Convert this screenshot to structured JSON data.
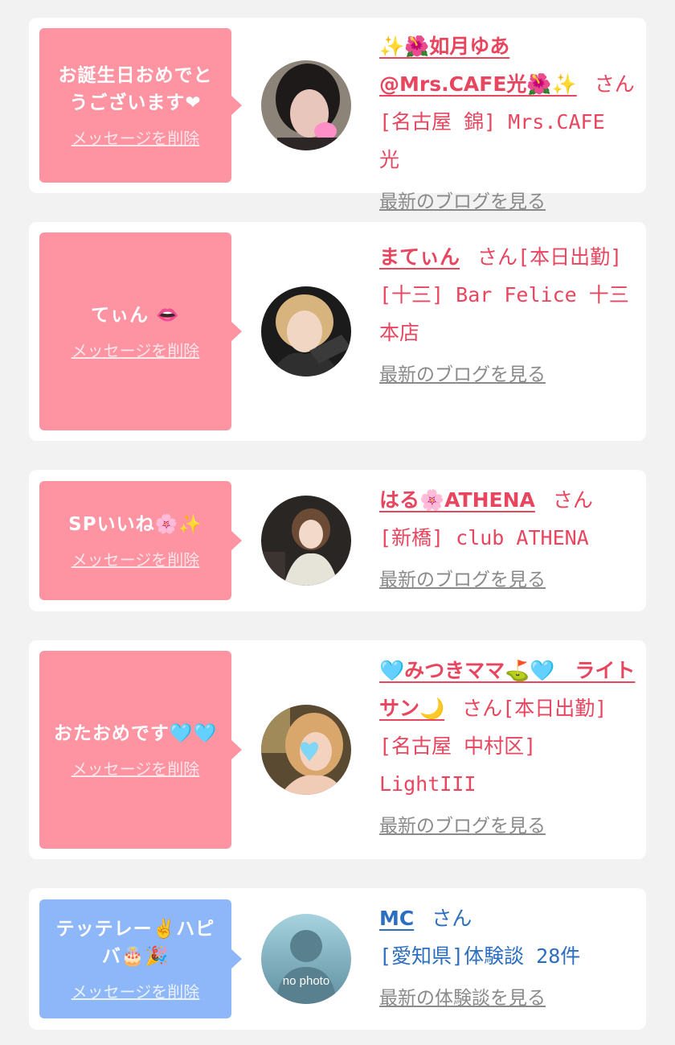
{
  "items": [
    {
      "theme": "pink",
      "message": "お誕生日おめでとうございます❤",
      "delete_label": "メッセージを削除",
      "name": "✨🌺如月ゆあ@Mrs.CAFE光🌺✨",
      "san": "さん",
      "after": "",
      "store": "[名古屋 錦] Mrs.CAFE 光",
      "link": "最新のブログを見る"
    },
    {
      "theme": "pink",
      "message": "てぃん 👄",
      "delete_label": "メッセージを削除",
      "name": "まてぃん",
      "san": "さん",
      "after": "[本日出勤]",
      "store": "[十三] Bar Felice 十三本店",
      "link": "最新のブログを見る"
    },
    {
      "theme": "pink",
      "message": "SPいいね🌸✨",
      "delete_label": "メッセージを削除",
      "name": "はる🌸ATHENA",
      "san": "さん",
      "after": "",
      "store": "[新橋] club ATHENA",
      "link": "最新のブログを見る"
    },
    {
      "theme": "pink",
      "message": "おたおめです🩵🩵",
      "delete_label": "メッセージを削除",
      "name": "🩵みつきママ⛳️🩵　ライトサン🌙",
      "san": "さん",
      "after": "[本日出勤]",
      "store": "[名古屋 中村区] LightIII",
      "link": "最新のブログを見る"
    },
    {
      "theme": "blue",
      "message": "テッテレー✌️ハピバ🎂🎉",
      "delete_label": "メッセージを削除",
      "name": "MC",
      "san": "さん",
      "after": "",
      "store": "[愛知県]体験談 28件",
      "link": "最新の体験談を見る",
      "avatar_text": "no photo"
    }
  ],
  "colors": {
    "bubble_pink": "#fe93a2",
    "bubble_blue": "#8db7f8",
    "text_pink": "#e8455f",
    "text_blue": "#2c6fc0",
    "link_gray": "#8a8a8a"
  }
}
